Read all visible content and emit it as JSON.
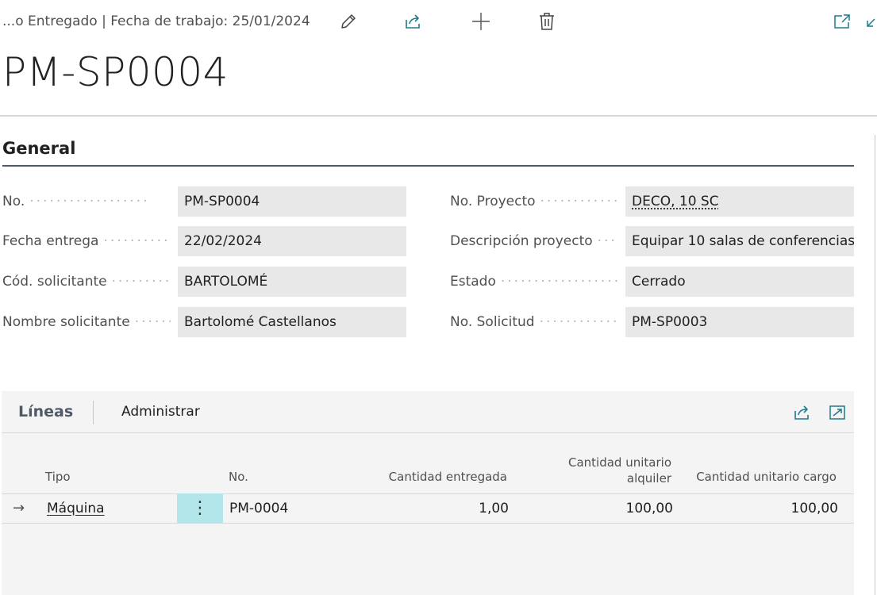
{
  "header": {
    "breadcrumb": "...o Entregado | Fecha de trabajo: 25/01/2024",
    "title": "PM-SP0004",
    "icons": [
      "edit-icon",
      "share-icon",
      "new-icon",
      "delete-icon",
      "open-new-window-icon",
      "collapse-icon"
    ]
  },
  "general": {
    "title": "General",
    "fields_left": [
      {
        "label": "No.",
        "value": "PM-SP0004"
      },
      {
        "label": "Fecha entrega",
        "value": "22/02/2024"
      },
      {
        "label": "Cód. solicitante",
        "value": "BARTOLOMÉ"
      },
      {
        "label": "Nombre solicitante",
        "value": "Bartolomé Castellanos"
      }
    ],
    "fields_right": [
      {
        "label": "No. Proyecto",
        "value": "DECO, 10 SC"
      },
      {
        "label": "Descripción proyecto",
        "value": "Equipar 10 salas de conferencias"
      },
      {
        "label": "Estado",
        "value": "Cerrado"
      },
      {
        "label": "No. Solicitud",
        "value": "PM-SP0003"
      }
    ]
  },
  "lines": {
    "tab_active": "Líneas",
    "tab_manage": "Administrar",
    "columns": {
      "tipo": "Tipo",
      "no": "No.",
      "cant_entregada": "Cantidad entregada",
      "cant_alquiler_1": "Cantidad unitario",
      "cant_alquiler_2": "alquiler",
      "cant_cargo": "Cantidad unitario cargo"
    },
    "rows": [
      {
        "tipo": "Máquina",
        "no": "PM-0004",
        "cant_entregada": "1,00",
        "cant_alquiler": "100,00",
        "cant_cargo": "100,00"
      }
    ]
  },
  "colors": {
    "accent": "#505a66",
    "selected_cell": "#b3e6ea",
    "field_bg": "#e8e8e8",
    "icon_blue": "#1f7a8c"
  }
}
